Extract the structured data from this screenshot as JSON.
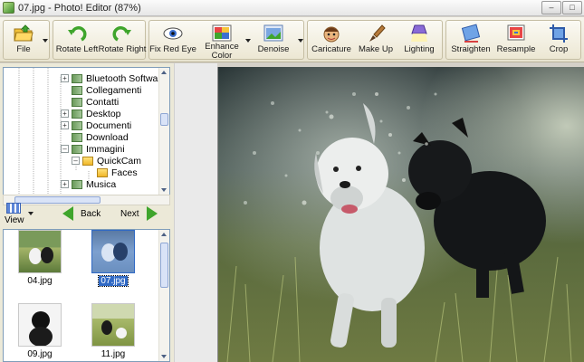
{
  "window": {
    "title": "07.jpg - Photo! Editor (87%)"
  },
  "toolbar": {
    "file": "File",
    "rotate_left": "Rotate Left",
    "rotate_right": "Rotate Right",
    "fix_red_eye": "Fix Red Eye",
    "enhance_color_1": "Enhance",
    "enhance_color_2": "Color",
    "denoise": "Denoise",
    "caricature": "Caricature",
    "make_up": "Make Up",
    "lighting": "Lighting",
    "straighten": "Straighten",
    "resample": "Resample",
    "crop": "Crop"
  },
  "tree": {
    "items": [
      {
        "label": "Bluetooth Software",
        "expandable": true,
        "folder": "green"
      },
      {
        "label": "Collegamenti",
        "expandable": false,
        "folder": "green"
      },
      {
        "label": "Contatti",
        "expandable": false,
        "folder": "green"
      },
      {
        "label": "Desktop",
        "expandable": true,
        "folder": "green"
      },
      {
        "label": "Documenti",
        "expandable": true,
        "folder": "green"
      },
      {
        "label": "Download",
        "expandable": false,
        "folder": "green"
      },
      {
        "label": "Immagini",
        "expandable": true,
        "expanded": true,
        "folder": "green"
      },
      {
        "label": "QuickCam",
        "expandable": true,
        "expanded": true,
        "folder": "yellow"
      },
      {
        "label": "Faces",
        "expandable": false,
        "folder": "yellow"
      },
      {
        "label": "Musica",
        "expandable": true,
        "folder": "green"
      }
    ]
  },
  "nav": {
    "view": "View",
    "back": "Back",
    "next": "Next"
  },
  "thumbnails": [
    {
      "caption": "04.jpg",
      "selected": false
    },
    {
      "caption": "07.jpg",
      "selected": true
    },
    {
      "caption": "09.jpg",
      "selected": false
    },
    {
      "caption": "11.jpg",
      "selected": false
    }
  ],
  "colors": {
    "accent": "#316ac5",
    "nav_arrow": "#3fa52c"
  }
}
